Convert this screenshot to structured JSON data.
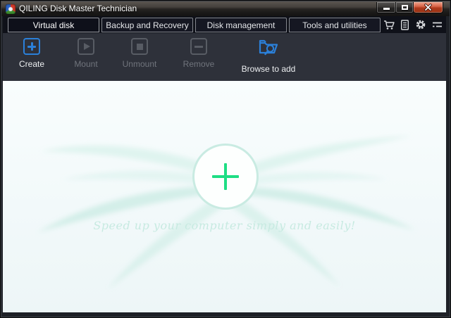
{
  "window": {
    "title": "QILING Disk Master Technician",
    "controls": [
      {
        "name": "minimize"
      },
      {
        "name": "maximize"
      },
      {
        "name": "close"
      }
    ]
  },
  "tabs": [
    {
      "label": "Virtual disk",
      "active": true
    },
    {
      "label": "Backup and Recovery",
      "active": false
    },
    {
      "label": "Disk management",
      "active": false
    },
    {
      "label": "Tools and utilities",
      "active": false
    }
  ],
  "header_icons": [
    {
      "name": "cart-icon"
    },
    {
      "name": "license-icon"
    },
    {
      "name": "settings-gear-icon"
    },
    {
      "name": "menu-icon"
    }
  ],
  "toolbar": {
    "buttons": [
      {
        "label": "Create",
        "enabled": true,
        "icon": "create-icon"
      },
      {
        "label": "Mount",
        "enabled": false,
        "icon": "mount-icon"
      },
      {
        "label": "Unmount",
        "enabled": false,
        "icon": "unmount-icon"
      },
      {
        "label": "Remove",
        "enabled": false,
        "icon": "remove-icon"
      },
      {
        "label": "Browse to add",
        "enabled": true,
        "icon": "browse-to-add-icon"
      }
    ]
  },
  "main": {
    "tagline": "Speed up your computer simply and easily!",
    "add_symbol": "+"
  },
  "colors": {
    "accent_blue": "#2b80d9",
    "accent_green": "#1ede84",
    "circle_border": "#c9ebe2",
    "tagline_text": "#c7eae1",
    "tabbar_bg": "#0f1119",
    "toolbar_bg": "#2e313a",
    "close_button": "#b03a1d"
  }
}
